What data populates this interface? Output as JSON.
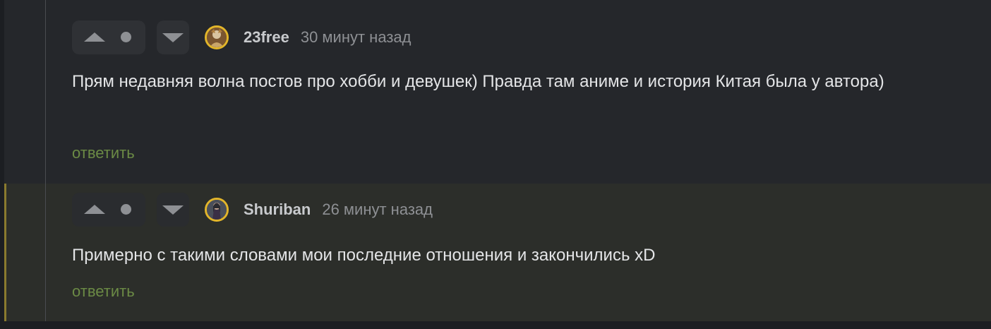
{
  "comments": [
    {
      "author": "23free",
      "time": "30 минут назад",
      "text": "Прям недавняя волна постов про хобби и девушек) Правда там аниме и история Китая была у автора)",
      "reply_label": "ответить",
      "icons": {
        "upvote": "triangle-up-icon",
        "score": "dot-icon",
        "downvote": "triangle-down-icon"
      }
    },
    {
      "author": "Shuriban",
      "time": "26 минут назад",
      "text": "Примерно с такими словами мои последние отношения и закончились xD",
      "reply_label": "ответить",
      "icons": {
        "upvote": "triangle-up-icon",
        "score": "dot-icon",
        "downvote": "triangle-down-icon"
      }
    }
  ],
  "colors": {
    "background": "#25272b",
    "highlight_background": "#2c2e2a",
    "highlight_bar": "#8a7a2e",
    "reply_link": "#6b8a45",
    "avatar_border": "#e2b52a"
  }
}
